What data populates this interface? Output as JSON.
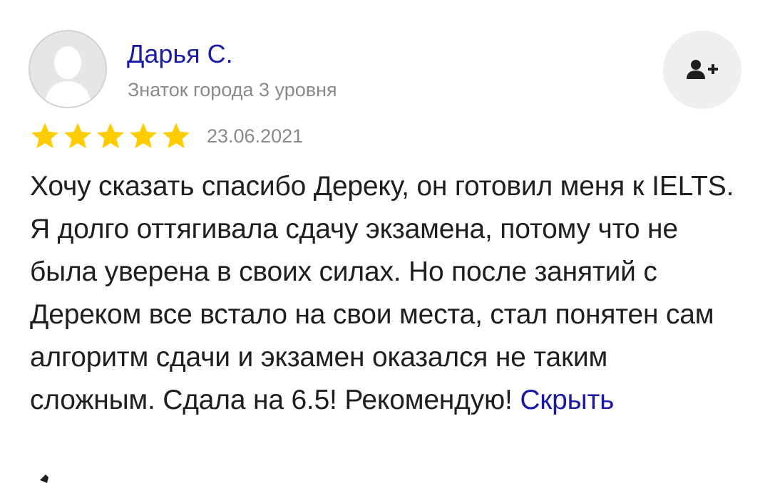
{
  "author": {
    "name": "Дарья С.",
    "level": "Знаток города 3 уровня",
    "avatar_icon": "user-silhouette-icon"
  },
  "actions": {
    "subscribe_icon": "add-user-icon"
  },
  "review": {
    "rating": 5,
    "rating_max": 5,
    "star_color": "#ffcc00",
    "date": "23.06.2021",
    "text": "Хочу сказать спасибо Дереку, он готовил меня к IELTS. Я долго оттягивала сдачу экзамена, потому что не была уверена в своих силах. Но после занятий с Дереком все встало на свои места, стал понятен сам алгоритм сдачи и экзамен оказался не таким сложным. Сдала на 6.5! Рекомендую!",
    "hide_label": "Скрыть"
  },
  "colors": {
    "link": "#1a1aa6",
    "secondary_text": "#8a8a8a",
    "button_bg": "#efefef"
  }
}
